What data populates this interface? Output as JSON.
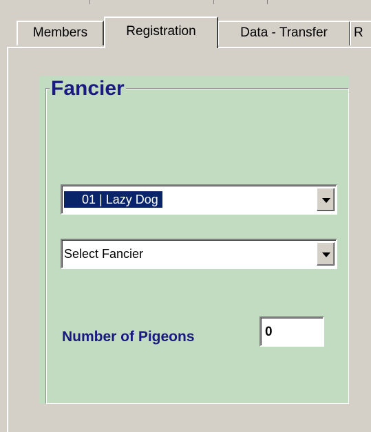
{
  "tabs": [
    {
      "label": "Members",
      "active": false
    },
    {
      "label": "Registration",
      "active": true
    },
    {
      "label": "Data - Transfer",
      "active": false
    },
    {
      "label": "R",
      "active": false
    }
  ],
  "group": {
    "title": "Fancier"
  },
  "combo1": {
    "value": "01 | Lazy Dog"
  },
  "combo2": {
    "value": "Select Fancier"
  },
  "pigeons": {
    "label": "Number of Pigeons",
    "value": "0"
  },
  "colors": {
    "panel_bg": "#c1dcc1",
    "label_color": "#1a1a80",
    "selection": "#0a246a",
    "window_bg": "#d4d0c8"
  },
  "icons": [
    "dropdown-arrow-icon"
  ]
}
